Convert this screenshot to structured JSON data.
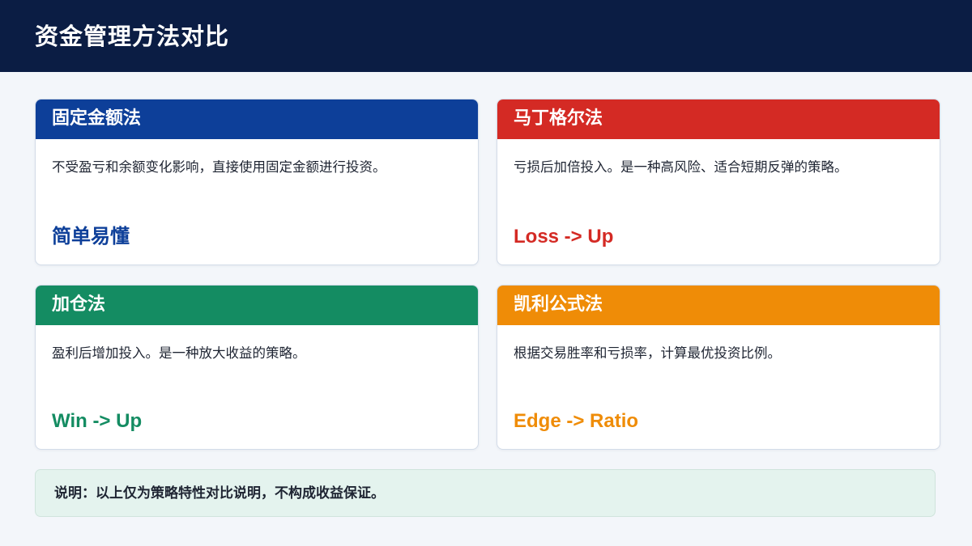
{
  "header": {
    "title": "资金管理方法对比"
  },
  "colors": {
    "header_bg": "#0b1d44",
    "blue": "#0d3f99",
    "red": "#d42a24",
    "green": "#148c62",
    "orange": "#ef8c07",
    "note_bg": "#e4f3ee"
  },
  "cards": [
    {
      "title": "固定金额法",
      "description": "不受盈亏和余额变化影响，直接使用固定金额进行投资。",
      "tag": "简单易懂",
      "color": "#0d3f99"
    },
    {
      "title": "马丁格尔法",
      "description": "亏损后加倍投入。是一种高风险、适合短期反弹的策略。",
      "tag": "Loss -> Up",
      "color": "#d42a24"
    },
    {
      "title": "加仓法",
      "description": "盈利后增加投入。是一种放大收益的策略。",
      "tag": "Win -> Up",
      "color": "#148c62"
    },
    {
      "title": "凯利公式法",
      "description": "根据交易胜率和亏损率，计算最优投资比例。",
      "tag": "Edge -> Ratio",
      "color": "#ef8c07"
    }
  ],
  "note": {
    "text": "说明：以上仅为策略特性对比说明，不构成收益保证。"
  }
}
